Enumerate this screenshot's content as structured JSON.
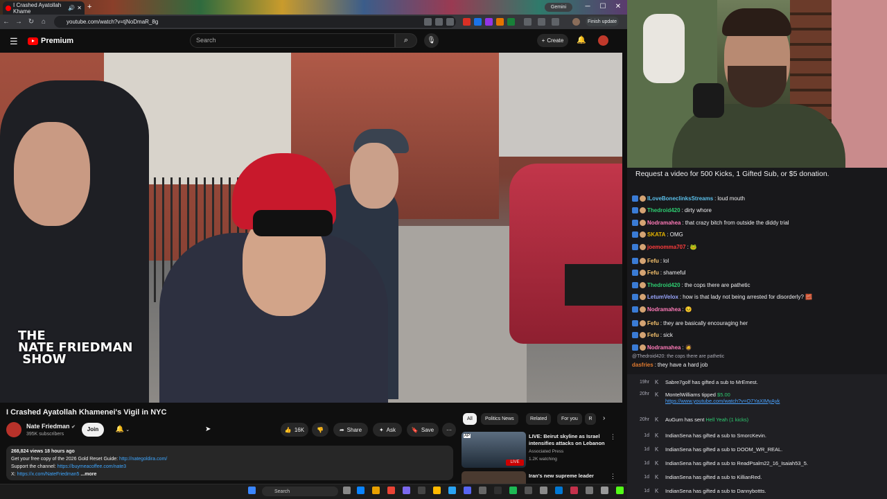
{
  "browser": {
    "tab_title": "I Crashed Ayatollah Khame",
    "gemini_label": "Gemini",
    "url": "youtube.com/watch?v=tjNoDmaR_8g",
    "finish_update_label": "Finish update"
  },
  "youtube": {
    "logo_text": "Premium",
    "search_placeholder": "Search",
    "create_label": "Create",
    "video": {
      "watermark": "THE\nNATE FRIEDMAN\n SHOW",
      "title": "I Crashed Ayatollah Khamenei's Vigil in NYC"
    },
    "channel": {
      "name": "Nate Friedman",
      "verified_mark": "✔",
      "subscribers": "395K subscribers",
      "join_label": "Join"
    },
    "actions": {
      "likes": "16K",
      "share": "Share",
      "ask": "Ask",
      "save": "Save"
    },
    "description": {
      "stats": "268,824 views  18 hours ago",
      "line1_text": "Get your free copy of the 2026 Gold Reset Guide: ",
      "line1_link": "http://nategoldira.com/",
      "line2_text": "Support the channel: ",
      "line2_link": "https://buymeacoffee.com/nate3",
      "line3_text": "X: ",
      "line3_link": "https://x.com/NateFriedman5",
      "more": "...more"
    },
    "filter_chips": [
      "All",
      "Politics News",
      "Related",
      "For you",
      "R"
    ],
    "recommendations": [
      {
        "title": "LIVE: Beirut skyline as Israel intensifies attacks on Lebanon",
        "source": "Associated Press",
        "meta": "1.2K watching",
        "badge": "LIVE",
        "thumb_text": "AP"
      },
      {
        "title": "Iran's new supreme leader",
        "source": "",
        "meta": "",
        "badge": "",
        "thumb_text": ""
      }
    ]
  },
  "taskbar": {
    "search_label": "Search"
  },
  "stream": {
    "caption": "Request a video for 500 Kicks, 1 Gifted Sub, or $5 donation.",
    "chat": [
      {
        "user": "ILoveBoneclinksStreams",
        "text": "loud mouth",
        "color": "#5bc0eb"
      },
      {
        "user": "Thedroid420",
        "text": "dirty whore",
        "color": "#2ecc71"
      },
      {
        "user": "Nodramahea",
        "text": "that crazy bitch from outside the diddy trial",
        "color": "#ff7ab8"
      },
      {
        "user": "SKATA",
        "text": "OMG",
        "color": "#e6b400"
      },
      {
        "user": "joemomma707",
        "text": "🐸",
        "color": "#ff3c3c"
      },
      {
        "user": "Fefu",
        "text": "lol",
        "color": "#f5c16c"
      },
      {
        "user": "Fefu",
        "text": "shameful",
        "color": "#f5c16c"
      },
      {
        "user": "Thedroid420",
        "text": "the cops there are pathetic",
        "color": "#2ecc71"
      },
      {
        "user": "LetumVelox",
        "text": "how is that lady not being arrested for disorderly? 🧱",
        "color": "#9aa6ff"
      },
      {
        "user": "Nodramahea",
        "text": "😣",
        "color": "#ff7ab8"
      },
      {
        "user": "Fefu",
        "text": "they are basically encouraging her",
        "color": "#f5c16c"
      },
      {
        "user": "Fefu",
        "text": "sick",
        "color": "#f5c16c"
      },
      {
        "user": "Nodramahea",
        "text": "🧔",
        "color": "#ff7ab8"
      }
    ],
    "reply_hint": "@Thedroid420: the cops there are pathetic",
    "reply": {
      "user": "dasfries",
      "text": "they have a hard job",
      "color": "#e07a2f"
    },
    "events": [
      {
        "time": "19hr",
        "text": "Sabre7golf has gifted a sub to ",
        "target": "MrEmest."
      },
      {
        "time": "20hr",
        "text": "MontelWilliams tipped ",
        "target": "$5.00",
        "link": "https://www.youtube.com/watch?v=O7YaXIMyAyk"
      },
      {
        "time": "20hr",
        "text": "AuGurn has sent ",
        "target": "Hell Yeah (1 kicks)"
      },
      {
        "time": "1d",
        "text": "IndianSena has gifted a sub to ",
        "target": "SmorcKevin."
      },
      {
        "time": "1d",
        "text": "IndianSena has gifted a sub to ",
        "target": "DOOM_WR_REAL."
      },
      {
        "time": "1d",
        "text": "IndianSena has gifted a sub to ",
        "target": "ReadPsalm22_16_Isaiah53_5."
      },
      {
        "time": "1d",
        "text": "IndianSena has gifted a sub to ",
        "target": "KillianRed."
      },
      {
        "time": "1d",
        "text": "IndianSena has gifted a sub to ",
        "target": "Dannybottts."
      }
    ]
  },
  "colors": {
    "yt_red": "#ff0000",
    "link_blue": "#3ea6ff",
    "chat_bg": "#18181b"
  }
}
